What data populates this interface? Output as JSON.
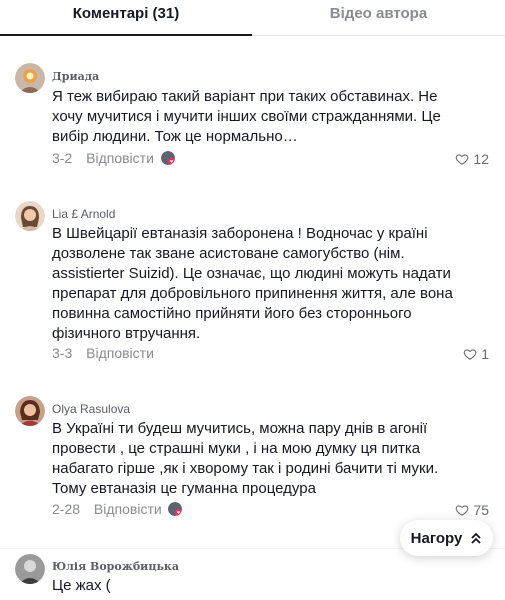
{
  "tabs": {
    "comments_label": "Коментарі (31)",
    "author_videos_label": "Відео автора"
  },
  "comments": [
    {
      "author": "Дриада",
      "text": "Я теж вибираю такий варіант при таких обставинах. Не хочу мучитися і мучити інших своїми стражданнями. Це вибір людини. Тож це нормально…",
      "date": "3-2",
      "reply_label": "Відповісти",
      "likes": "12",
      "creator_liked": true
    },
    {
      "author": "Lia £ Arnold",
      "text": "В Швейцарії евтаназія заборонена ! Водночас у країні дозволене так зване асистоване самогубство (нім. assistierter Suizid). Це означає, що людині можуть надати препарат для добровільного припинення життя, але вона повинна самостійно прийняти його без стороннього фізичного втручання.",
      "date": "3-3",
      "reply_label": "Відповісти",
      "likes": "1",
      "creator_liked": false
    },
    {
      "author": "Olya Rasulova",
      "text": "В Україні ти будеш мучитись, можна пару днів в агонії провести , це страшні муки , і на мою думку ця питка набагато гірше ,як і хворому так і родині бачити ті муки. Тому евтаназія це гуманна процедура",
      "date": "2-28",
      "reply_label": "Відповісти",
      "likes": "75",
      "creator_liked": true
    },
    {
      "author": "Юлія Ворожбицька",
      "text": "Це жах (",
      "date": "",
      "reply_label": "",
      "likes": "",
      "creator_liked": false
    }
  ],
  "scroll_top": {
    "label": "Нагору",
    "icon": "double-chevron-up-icon"
  },
  "icons": {
    "like": "heart-outline-icon"
  },
  "colors": {
    "text_primary": "#161823",
    "text_secondary": "#8a8b91",
    "brand_red": "#fe2c55"
  }
}
